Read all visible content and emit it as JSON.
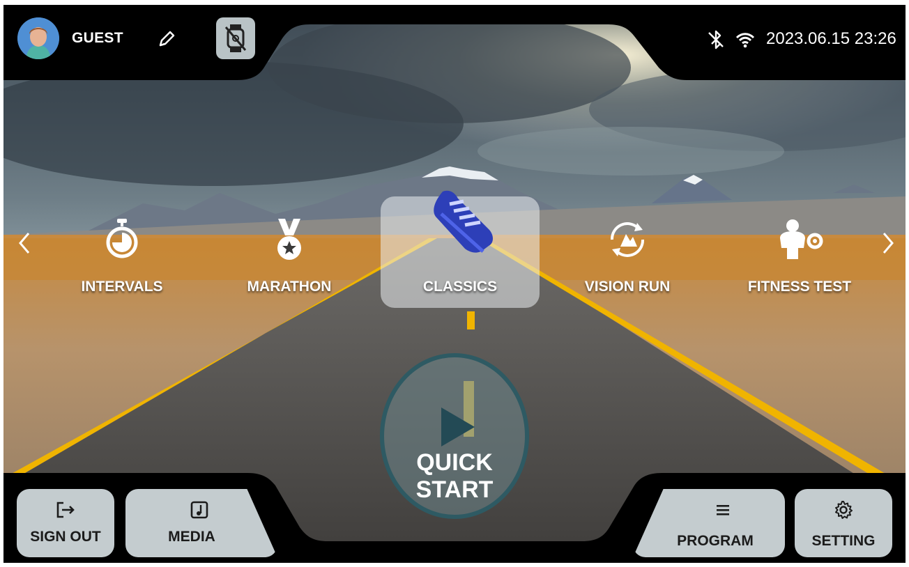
{
  "header": {
    "user_name": "GUEST",
    "datetime": "2023.06.15 23:26"
  },
  "programs": {
    "items": [
      {
        "label": "INTERVALS",
        "icon": "stopwatch-icon"
      },
      {
        "label": "MARATHON",
        "icon": "medal-icon"
      },
      {
        "label": "CLASSICS",
        "icon": "running-shoe-icon",
        "selected": true
      },
      {
        "label": "VISION RUN",
        "icon": "scenic-route-icon"
      },
      {
        "label": "FITNESS TEST",
        "icon": "muscle-gear-icon"
      }
    ]
  },
  "quick_start": {
    "line1": "QUICK",
    "line2": "START"
  },
  "footer": {
    "sign_out_label": "SIGN OUT",
    "media_label": "MEDIA",
    "program_label": "PROGRAM",
    "setting_label": "SETTING"
  },
  "colors": {
    "accent_blue": "#2d3fb8",
    "button_grey": "#c4cccf",
    "road_yellow": "#f0b400",
    "quick_start_ring": "#2e5a63"
  }
}
